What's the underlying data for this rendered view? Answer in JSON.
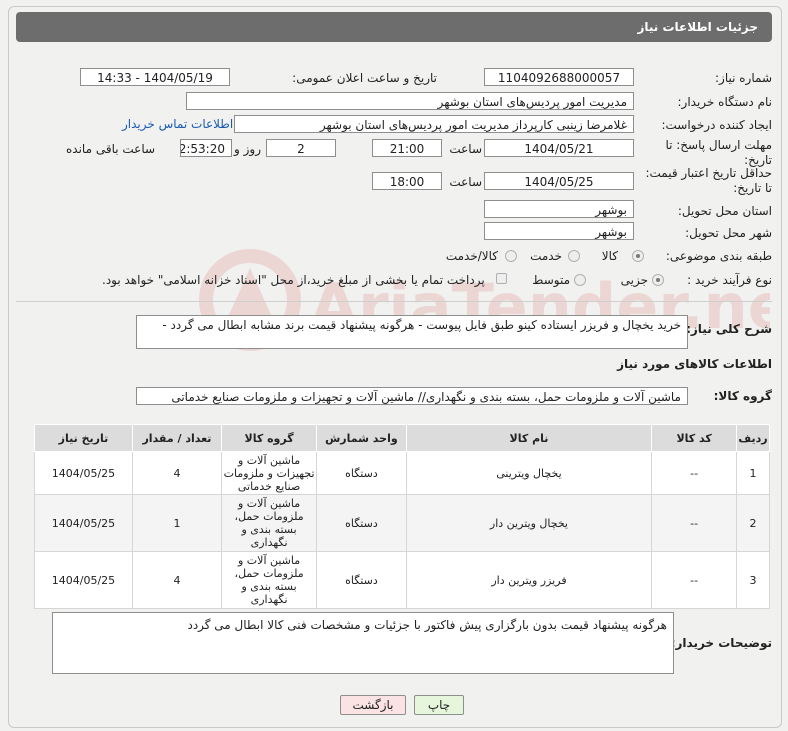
{
  "header": {
    "title": "جزئیات اطلاعات نیاز"
  },
  "fields": {
    "need_number_label": "شماره نیاز:",
    "need_number": "1104092688000057",
    "announce_label": "تاریخ و ساعت اعلان عمومی:",
    "announce_value": "1404/05/19 - 14:33",
    "buyer_org_label": "نام دستگاه خریدار:",
    "buyer_org": "مدیریت امور پردیس‌های استان بوشهر",
    "creator_label": "ایجاد کننده درخواست:",
    "creator": "غلامرضا زینبی کارپرداز مدیریت امور پردیس‌های استان بوشهر",
    "contact_link": "اطلاعات تماس خریدار",
    "reply_deadline_label": "مهلت ارسال پاسخ: تا تاریخ:",
    "reply_date": "1404/05/21",
    "time_label": "ساعت",
    "reply_time": "21:00",
    "days_value": "2",
    "days_label": "روز و",
    "remaining_time": "02:53:20",
    "remaining_label": "ساعت باقی مانده",
    "validity_label": "حداقل تاریخ اعتبار قیمت: تا تاریخ:",
    "validity_date": "1404/05/25",
    "validity_time": "18:00",
    "province_label": "استان محل تحویل:",
    "province": "بوشهر",
    "city_label": "شهر محل تحویل:",
    "city": "بوشهر",
    "category_label": "طبقه بندی موضوعی:",
    "category_options": [
      "کالا",
      "خدمت",
      "کالا/خدمت"
    ],
    "process_label": "نوع فرآیند خرید :",
    "process_options": [
      "جزیی",
      "متوسط"
    ],
    "payment_note": "پرداخت تمام یا بخشی از مبلغ خرید،از محل \"اسناد خزانه اسلامی\" خواهد بود."
  },
  "description": {
    "label": "شرح کلی نیاز:",
    "text": "خرید یخچال و فریزر ایستاده کینو طبق فایل پیوست - هرگونه پیشنهاد قیمت برند مشابه ابطال می گردد -"
  },
  "goods": {
    "section_title": "اطلاعات کالاهای مورد نیاز",
    "group_label": "گروه کالا:",
    "group_value": "ماشین آلات و ملزومات حمل، بسته بندی و نگهداری// ماشین آلات و تجهیزات و ملزومات صنایع خدماتی",
    "columns": [
      "ردیف",
      "کد کالا",
      "نام کالا",
      "واحد شمارش",
      "گروه کالا",
      "تعداد / مقدار",
      "تاریخ نیاز"
    ],
    "rows": [
      {
        "idx": "1",
        "code": "--",
        "name": "یخچال ویترینی",
        "unit": "دستگاه",
        "group": "ماشین آلات و تجهیزات و ملزومات صنایع خدماتی",
        "qty": "4",
        "date": "1404/05/25"
      },
      {
        "idx": "2",
        "code": "--",
        "name": "یخچال ویترین دار",
        "unit": "دستگاه",
        "group": "ماشین آلات و ملزومات حمل، بسته بندی و نگهداری",
        "qty": "1",
        "date": "1404/05/25"
      },
      {
        "idx": "3",
        "code": "--",
        "name": "فریزر ویترین دار",
        "unit": "دستگاه",
        "group": "ماشین آلات و ملزومات حمل، بسته بندی و نگهداری",
        "qty": "4",
        "date": "1404/05/25"
      }
    ]
  },
  "buyer_notes": {
    "label": "توضیحات خریدار:",
    "text": "هرگونه پیشنهاد قیمت بدون بارگزاری پیش فاکتور با جزئیات و مشخصات فنی کالا ابطال می گردد"
  },
  "buttons": {
    "print": "چاپ",
    "back": "بازگشت"
  },
  "watermark": {
    "text": "AriaTender.net"
  },
  "colors": {
    "header_bg": "#6d6d6d",
    "link": "#1a5bb3",
    "print_bg": "#e6f6dc",
    "back_bg": "#fbe3e3"
  }
}
